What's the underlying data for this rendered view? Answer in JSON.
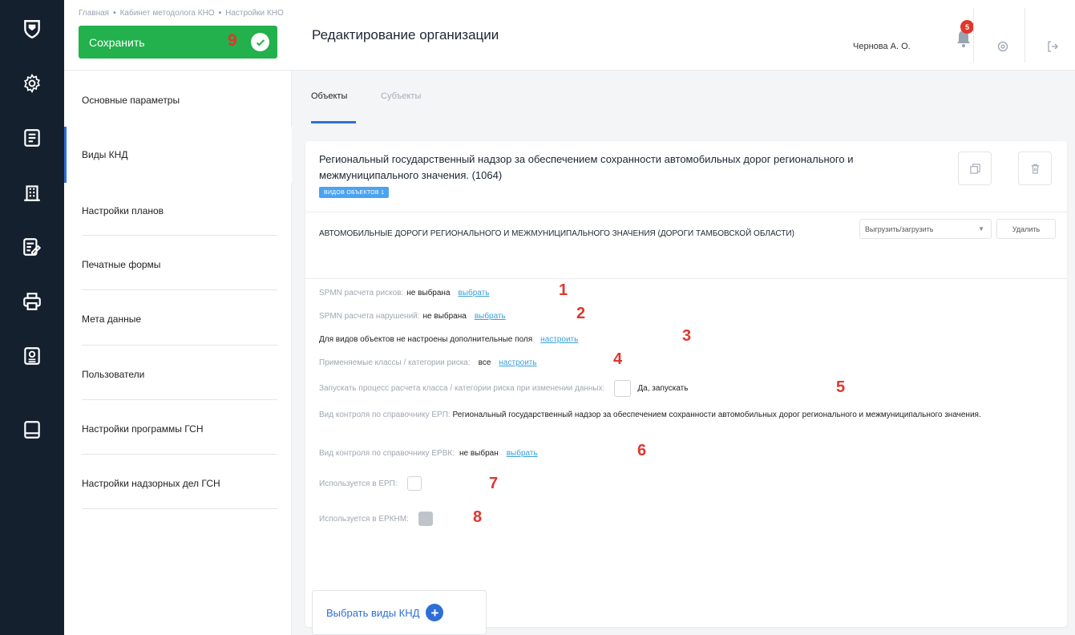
{
  "header": {
    "breadcrumb": [
      "Главная",
      "Кабинет методолога КНО",
      "Настройки КНО"
    ],
    "save_label": "Сохранить",
    "save_marker": "9",
    "page_title": "Редактирование организации",
    "user_name": "Чернова А. О.",
    "notifications_count": "5"
  },
  "rail": {
    "icons": [
      "logo-shield-icon",
      "gear-icon",
      "document-list-icon",
      "building-icon",
      "checklist-edit-icon",
      "printer-icon",
      "report-icon",
      "book-icon"
    ]
  },
  "sidebar": {
    "items": [
      {
        "label": "Основные параметры",
        "active": false
      },
      {
        "label": "Виды КНД",
        "active": true
      },
      {
        "label": "Настройки планов",
        "active": false
      },
      {
        "label": "Печатные формы",
        "active": false
      },
      {
        "label": "Мета данные",
        "active": false
      },
      {
        "label": "Пользователи",
        "active": false
      },
      {
        "label": "Настройки программы ГСН",
        "active": false
      },
      {
        "label": "Настройки надзорных дел ГСН",
        "active": false
      }
    ]
  },
  "tabs": [
    {
      "label": "Объекты",
      "active": true
    },
    {
      "label": "Субъекты",
      "active": false
    }
  ],
  "card": {
    "title": "Региональный государственный надзор за обеспечением сохранности автомобильных дорог регионального и межмуниципального значения. (1064)",
    "tag": "ВИДОВ ОБЪЕКТОВ 1",
    "object_name": "АВТОМОБИЛЬНЫЕ ДОРОГИ РЕГИОНАЛЬНОГО И МЕЖМУНИЦИПАЛЬНОГО ЗНАЧЕНИЯ (ДОРОГИ ТАМБОВСКОЙ ОБЛАСТИ)",
    "export_select": "Выгрузить/загрузить",
    "delete_label": "Удалить",
    "props": {
      "risk_formula_label": "SPMN расчета рисков:",
      "risk_formula_value": "не выбрана",
      "risk_formula_link": "выбрать",
      "violation_formula_label": "SPMN расчета нарушений:",
      "violation_formula_value": "не выбрана",
      "violation_formula_link": "выбрать",
      "extra_fields_text": "Для видов объектов не настроены дополнительные поля",
      "extra_fields_link": "настроить",
      "risk_classes_label": "Применяемые классы / категории риска:",
      "risk_classes_value": "все",
      "risk_classes_link": "настроить",
      "run_calc_label": "Запускать процесс расчета класса / категории риска при изменении данных:",
      "run_calc_option": "Да, запускать",
      "erp_kind_label": "Вид контроля по справочнику ЕРП:",
      "erp_kind_value": "Региональный государственный надзор за обеспечением сохранности автомобильных дорог регионального и межмуниципального значения.",
      "erpk_kind_label": "Вид контроля по справочнику ЕРВК:",
      "erpk_kind_value": "не выбран",
      "erpk_kind_link": "выбрать",
      "used_erp_label": "Используется в ЕРП:",
      "used_erknm_label": "Используется в ЕРКНМ:"
    },
    "markers": [
      "1",
      "2",
      "3",
      "4",
      "5",
      "6",
      "7",
      "8"
    ]
  },
  "add_button_label": "Выбрать виды КНД",
  "colors": {
    "rail_bg": "#15202f",
    "save_green": "#22b14c",
    "accent_blue": "#2e6fd6",
    "link_blue": "#3aa0d8",
    "marker_red": "#e0362c"
  }
}
